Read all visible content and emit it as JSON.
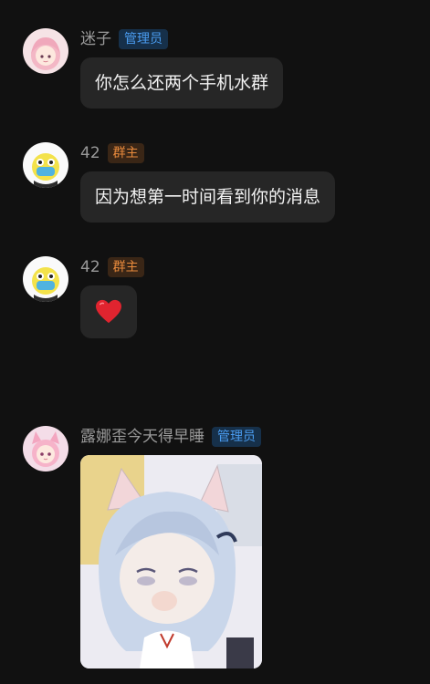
{
  "messages": [
    {
      "sender": "迷子",
      "role_badge": "管理员",
      "text": "你怎么还两个手机水群",
      "avatar_icon": "anime-girl-pink-avatar"
    },
    {
      "sender": "42",
      "role_badge": "群主",
      "text": "因为想第一时间看到你的消息",
      "avatar_icon": "yellow-mascot-avatar"
    },
    {
      "sender": "42",
      "role_badge": "群主",
      "emoji": "red-heart",
      "avatar_icon": "yellow-mascot-avatar"
    },
    {
      "sender": "露娜歪今天得早睡",
      "role_badge": "管理员",
      "image": "anime-cat-girl-sticker",
      "avatar_icon": "anime-cat-girl-avatar"
    }
  ],
  "colors": {
    "background": "#111111",
    "bubble": "#262626",
    "admin_badge_text": "#4a9cf0",
    "owner_badge_text": "#e88a3c"
  }
}
